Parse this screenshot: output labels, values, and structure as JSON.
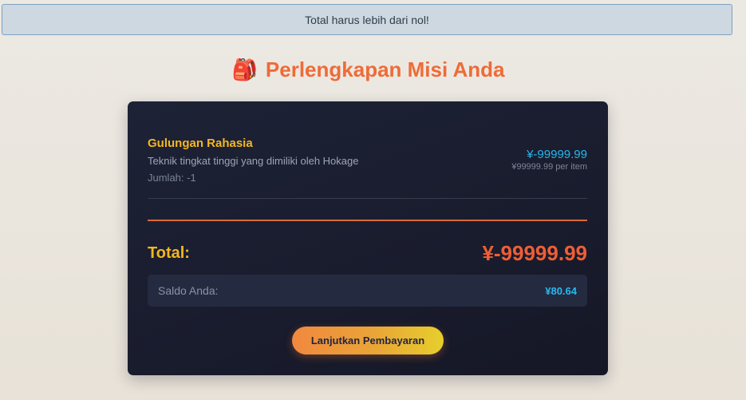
{
  "alert": {
    "message": "Total harus lebih dari nol!"
  },
  "header": {
    "icon": "backpack-icon",
    "icon_glyph": "🎒",
    "title": "Perlengkapan Misi Anda"
  },
  "cart": {
    "items": [
      {
        "name": "Gulungan Rahasia",
        "description": "Teknik tingkat tinggi yang dimiliki oleh Hokage",
        "quantity": "Jumlah: -1",
        "price": "¥-99999.99",
        "unit_price": "¥99999.99 per item"
      }
    ],
    "total_label": "Total:",
    "total_value": "¥-99999.99",
    "balance_label": "Saldo Anda:",
    "balance_value": "¥80.64",
    "pay_button_label": "Lanjutkan Pembayaran"
  },
  "colors": {
    "accent_orange": "#ef6b37",
    "accent_yellow": "#f3b71f",
    "accent_blue": "#2bb6ea",
    "card_background": "#1d2236"
  }
}
